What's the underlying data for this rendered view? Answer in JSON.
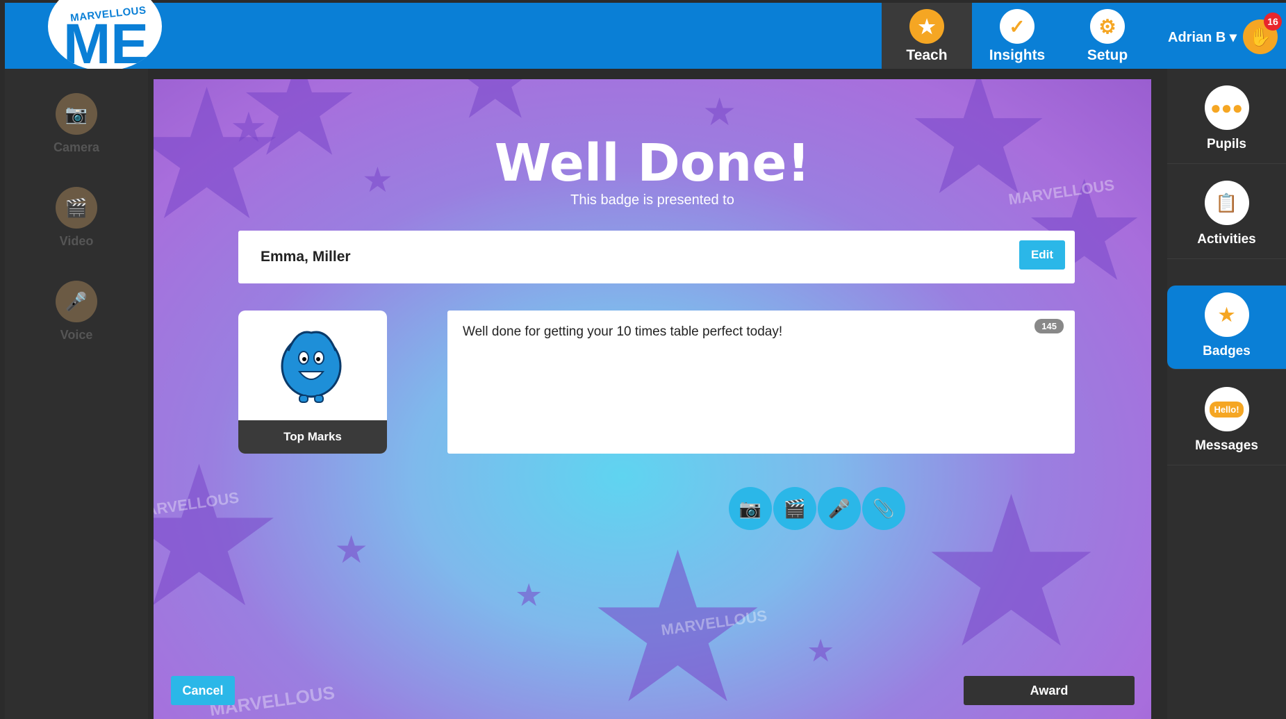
{
  "header": {
    "logo_text": "MARVELLOUS",
    "logo_me": "ME",
    "nav": [
      {
        "label": "Teach",
        "icon": "teach-star-icon"
      },
      {
        "label": "Insights",
        "icon": "checkmark-icon"
      },
      {
        "label": "Setup",
        "icon": "gear-icon"
      }
    ],
    "user_name": "Adrian B",
    "notification_count": "16"
  },
  "left_tools": [
    {
      "label": "Camera",
      "icon": "camera-icon"
    },
    {
      "label": "Video",
      "icon": "video-clapper-icon"
    },
    {
      "label": "Voice",
      "icon": "microphone-icon"
    }
  ],
  "right_nav": [
    {
      "label": "Pupils",
      "icon": "pupils-icon"
    },
    {
      "label": "Activities",
      "icon": "clipboard-icon"
    },
    {
      "label": "Badges",
      "icon": "badge-star-icon",
      "active": true
    },
    {
      "label": "Messages",
      "icon": "speech-bubble-icon",
      "bubble_text": "Hello!"
    }
  ],
  "award": {
    "title": "Well Done!",
    "subtitle": "This badge is presented to",
    "recipient": "Emma, Miller",
    "edit_label": "Edit",
    "badge_name": "Top Marks",
    "message": "Well done for getting your 10 times table perfect today!",
    "char_count": "145",
    "cancel_label": "Cancel",
    "award_label": "Award"
  },
  "background_watermark": "MARVELLOUS",
  "colors": {
    "primary_blue": "#0a7fd6",
    "accent_cyan": "#2bb7e8",
    "orange": "#f5a623",
    "dark": "#2f2f2f",
    "notification_red": "#e8262c"
  }
}
